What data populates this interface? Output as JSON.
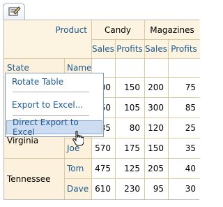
{
  "toolbar": {
    "icon": "export-edit-icon"
  },
  "grid": {
    "product_label": "Product",
    "products": [
      "Candy",
      "Magazines"
    ],
    "measures": [
      "Sales",
      "Profits",
      "Sales",
      "Profits"
    ],
    "state_label": "State",
    "name_label": "Name",
    "rows": [
      {
        "state": "",
        "name": "",
        "values": [
          "00",
          "150",
          "200",
          "75"
        ]
      },
      {
        "state": "",
        "name": "",
        "values": [
          "50",
          "105",
          "300",
          "85"
        ]
      },
      {
        "state": "",
        "name": "",
        "values": [
          "35",
          "80",
          "120",
          "25"
        ]
      },
      {
        "state": "Virginia",
        "name": "Joe",
        "values": [
          "570",
          "175",
          "150",
          "35"
        ]
      },
      {
        "state": "Tennessee",
        "name": "Tom",
        "values": [
          "475",
          "125",
          "205",
          "40"
        ]
      },
      {
        "state": "",
        "name": "Dave",
        "values": [
          "610",
          "230",
          "95",
          "30"
        ]
      }
    ]
  },
  "context_menu": {
    "items": [
      "Rotate Table",
      "Export to Excel...",
      "Direct Export to Excel"
    ],
    "highlighted": "Direct Export to Excel"
  }
}
